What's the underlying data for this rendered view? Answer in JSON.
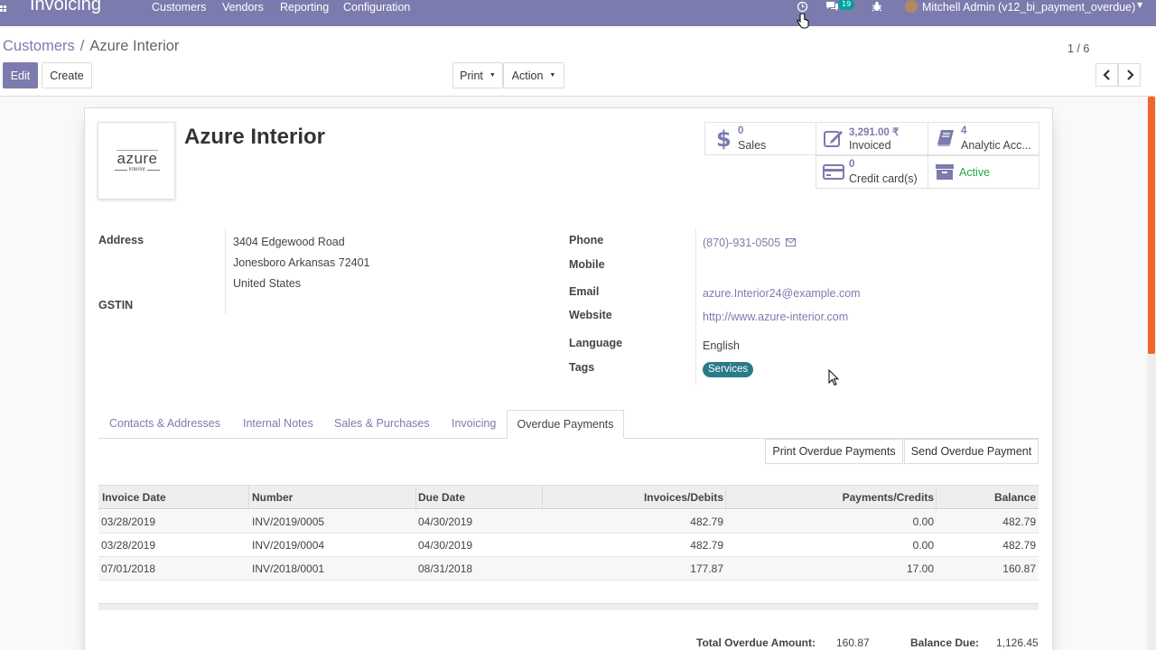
{
  "navbar": {
    "app_name": "Invoicing",
    "menu": [
      "Customers",
      "Vendors",
      "Reporting",
      "Configuration"
    ],
    "chat_count": "19",
    "user": "Mitchell Admin (v12_bi_payment_overdue)"
  },
  "breadcrumb": {
    "parent": "Customers",
    "separator": "/",
    "current": "Azure Interior"
  },
  "buttons": {
    "edit": "Edit",
    "create": "Create",
    "print": "Print",
    "action": "Action"
  },
  "pager": {
    "value": "1 / 6"
  },
  "record": {
    "name": "Azure Interior",
    "logo_text": "azure",
    "logo_sub": "interior"
  },
  "smart_buttons": {
    "sales": {
      "value": "0",
      "label": "Sales"
    },
    "invoiced": {
      "value": "3,291.00 ₹",
      "label": "Invoiced"
    },
    "analytic": {
      "value": "4",
      "label": "Analytic Acc..."
    },
    "credit_cards": {
      "value": "0",
      "label": "Credit card(s)"
    },
    "active": {
      "label": "Active"
    }
  },
  "fields": {
    "address_label": "Address",
    "address_line1": "3404 Edgewood Road",
    "address_line2": "Jonesboro  Arkansas  72401",
    "address_line3": "United States",
    "gstin_label": "GSTIN",
    "phone_label": "Phone",
    "phone_value": "(870)-931-0505",
    "mobile_label": "Mobile",
    "email_label": "Email",
    "email_value": "azure.Interior24@example.com",
    "website_label": "Website",
    "website_value": "http://www.azure-interior.com",
    "language_label": "Language",
    "language_value": "English",
    "tags_label": "Tags",
    "tag_value": "Services"
  },
  "tabs": {
    "contacts": "Contacts & Addresses",
    "notes": "Internal Notes",
    "sales": "Sales & Purchases",
    "invoicing": "Invoicing",
    "overdue": "Overdue Payments"
  },
  "overdue_actions": {
    "print": "Print Overdue Payments",
    "send": "Send Overdue Payment"
  },
  "table": {
    "headers": {
      "invoice_date": "Invoice Date",
      "number": "Number",
      "due_date": "Due Date",
      "debits": "Invoices/Debits",
      "credits": "Payments/Credits",
      "balance": "Balance"
    },
    "rows": [
      {
        "invoice_date": "03/28/2019",
        "number": "INV/2019/0005",
        "due_date": "04/30/2019",
        "debits": "482.79",
        "credits": "0.00",
        "balance": "482.79"
      },
      {
        "invoice_date": "03/28/2019",
        "number": "INV/2019/0004",
        "due_date": "04/30/2019",
        "debits": "482.79",
        "credits": "0.00",
        "balance": "482.79"
      },
      {
        "invoice_date": "07/01/2018",
        "number": "INV/2018/0001",
        "due_date": "08/31/2018",
        "debits": "177.87",
        "credits": "17.00",
        "balance": "160.87"
      }
    ]
  },
  "totals": {
    "overdue_label": "Total Overdue Amount:",
    "overdue_value": "160.87",
    "balance_label": "Balance Due:",
    "balance_value": "1,126.45"
  },
  "colors": {
    "brand": "#7c7bad",
    "accent_badge": "#00a09d",
    "active_green": "#28a745",
    "tag": "#2a7a8c",
    "scroll_thumb": "#f0652a"
  }
}
